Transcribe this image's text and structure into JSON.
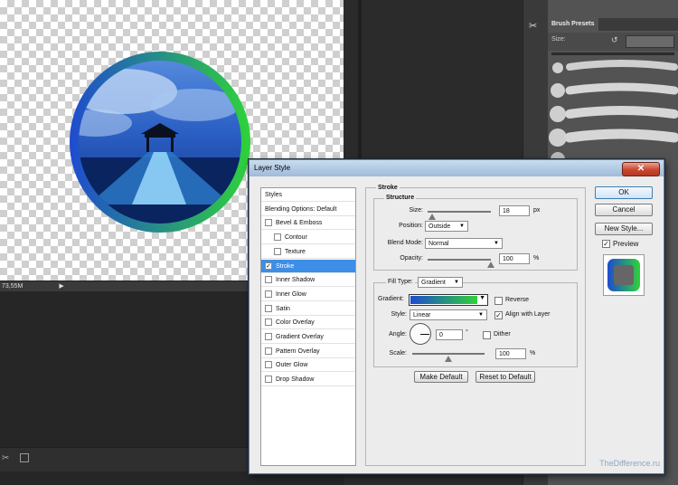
{
  "document": {
    "status_text": "73,55M"
  },
  "brush_panel": {
    "tab_label": "Brush Presets",
    "size_label": "Size:"
  },
  "dialog": {
    "title": "Layer Style",
    "close_glyph": "✕",
    "styles": [
      {
        "label": "Styles",
        "checkbox": false,
        "checked": false,
        "indent": 0,
        "selected": false
      },
      {
        "label": "Blending Options: Default",
        "checkbox": false,
        "checked": false,
        "indent": 0,
        "selected": false
      },
      {
        "label": "Bevel & Emboss",
        "checkbox": true,
        "checked": false,
        "indent": 0,
        "selected": false
      },
      {
        "label": "Contour",
        "checkbox": true,
        "checked": false,
        "indent": 1,
        "selected": false
      },
      {
        "label": "Texture",
        "checkbox": true,
        "checked": false,
        "indent": 1,
        "selected": false
      },
      {
        "label": "Stroke",
        "checkbox": true,
        "checked": true,
        "indent": 0,
        "selected": true
      },
      {
        "label": "Inner Shadow",
        "checkbox": true,
        "checked": false,
        "indent": 0,
        "selected": false
      },
      {
        "label": "Inner Glow",
        "checkbox": true,
        "checked": false,
        "indent": 0,
        "selected": false
      },
      {
        "label": "Satin",
        "checkbox": true,
        "checked": false,
        "indent": 0,
        "selected": false
      },
      {
        "label": "Color Overlay",
        "checkbox": true,
        "checked": false,
        "indent": 0,
        "selected": false
      },
      {
        "label": "Gradient Overlay",
        "checkbox": true,
        "checked": false,
        "indent": 0,
        "selected": false
      },
      {
        "label": "Pattern Overlay",
        "checkbox": true,
        "checked": false,
        "indent": 0,
        "selected": false
      },
      {
        "label": "Outer Glow",
        "checkbox": true,
        "checked": false,
        "indent": 0,
        "selected": false
      },
      {
        "label": "Drop Shadow",
        "checkbox": true,
        "checked": false,
        "indent": 0,
        "selected": false
      }
    ],
    "stroke": {
      "legend": "Stroke",
      "structure_legend": "Structure",
      "size_label": "Size:",
      "size_value": "18",
      "size_unit": "px",
      "size_fraction": 0.07,
      "position_label": "Position:",
      "position_value": "Outside",
      "blend_label": "Blend Mode:",
      "blend_value": "Normal",
      "opacity_label": "Opacity:",
      "opacity_value": "100",
      "opacity_unit": "%",
      "opacity_fraction": 1.0,
      "fill_type_label": "Fill Type:",
      "fill_type_value": "Gradient",
      "gradient_label": "Gradient:",
      "reverse_label": "Reverse",
      "reverse_checked": false,
      "style_label": "Style:",
      "style_value": "Linear",
      "align_label": "Align with Layer",
      "align_checked": true,
      "angle_label": "Angle:",
      "angle_value": "0",
      "angle_unit": "°",
      "dither_label": "Dither",
      "dither_checked": false,
      "scale_label": "Scale:",
      "scale_value": "100",
      "scale_unit": "%",
      "scale_fraction": 0.5,
      "make_default": "Make Default",
      "reset_default": "Reset to Default"
    },
    "buttons": {
      "ok": "OK",
      "cancel": "Cancel",
      "new_style": "New Style...",
      "preview_label": "Preview",
      "preview_checked": true
    },
    "check_glyph": "✓"
  },
  "watermark": "TheDifference.ru",
  "colors": {
    "gradient_start": "#1f4bd0",
    "gradient_end": "#2fd23a",
    "selection": "#3d8ee6"
  }
}
